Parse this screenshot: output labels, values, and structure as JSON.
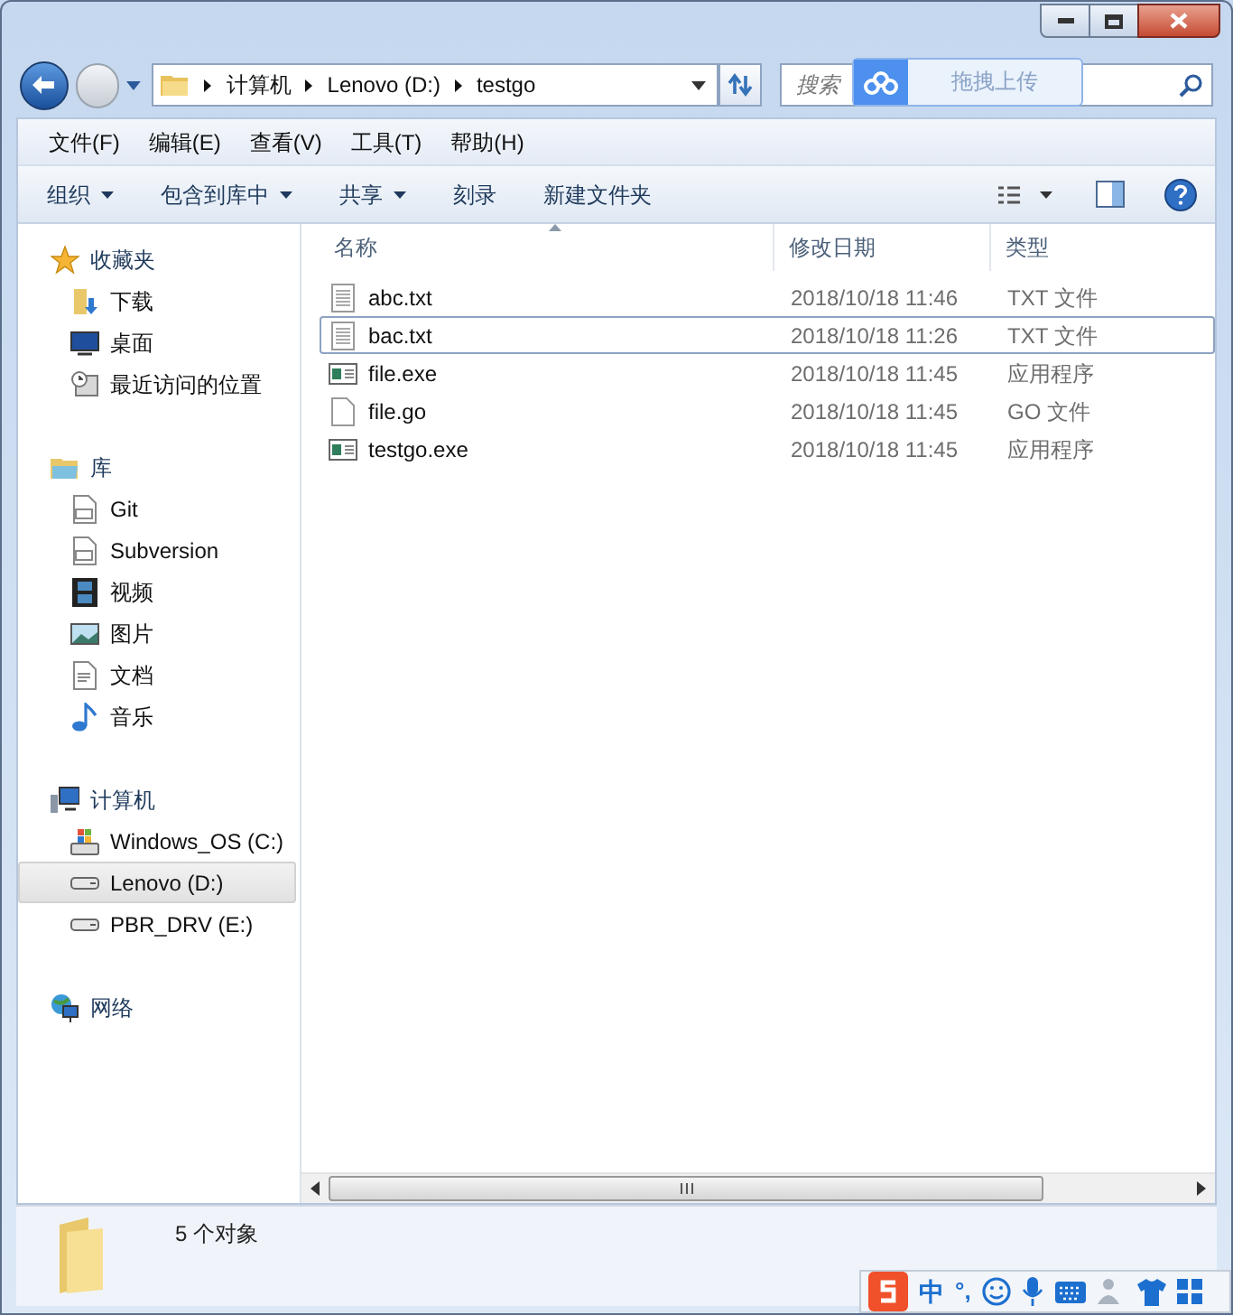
{
  "address_bar": {
    "segments": [
      "计算机",
      "Lenovo (D:)",
      "testgo"
    ]
  },
  "search": {
    "placeholder": "搜索"
  },
  "upload_overlay": {
    "label": "拖拽上传"
  },
  "menu": [
    "文件(F)",
    "编辑(E)",
    "查看(V)",
    "工具(T)",
    "帮助(H)"
  ],
  "toolbar": [
    {
      "label": "组织",
      "dropdown": true
    },
    {
      "label": "包含到库中",
      "dropdown": true
    },
    {
      "label": "共享",
      "dropdown": true
    },
    {
      "label": "刻录",
      "dropdown": false
    },
    {
      "label": "新建文件夹",
      "dropdown": false
    }
  ],
  "nav_pane": [
    {
      "label": "收藏夹",
      "kind": "star",
      "children": [
        {
          "label": "下载",
          "kind": "download",
          "selected": false
        },
        {
          "label": "桌面",
          "kind": "desktop",
          "selected": false
        },
        {
          "label": "最近访问的位置",
          "kind": "recent",
          "selected": false
        }
      ]
    },
    {
      "label": "库",
      "kind": "library",
      "children": [
        {
          "label": "Git",
          "kind": "git",
          "selected": false
        },
        {
          "label": "Subversion",
          "kind": "svn",
          "selected": false
        },
        {
          "label": "视频",
          "kind": "video",
          "selected": false
        },
        {
          "label": "图片",
          "kind": "picture",
          "selected": false
        },
        {
          "label": "文档",
          "kind": "document",
          "selected": false
        },
        {
          "label": "音乐",
          "kind": "music",
          "selected": false
        }
      ]
    },
    {
      "label": "计算机",
      "kind": "computer",
      "children": [
        {
          "label": "Windows_OS (C:)",
          "kind": "windows-drive",
          "selected": false
        },
        {
          "label": "Lenovo (D:)",
          "kind": "drive",
          "selected": true
        },
        {
          "label": "PBR_DRV (E:)",
          "kind": "drive",
          "selected": false
        }
      ]
    },
    {
      "label": "网络",
      "kind": "network"
    }
  ],
  "file_list": {
    "columns": [
      "名称",
      "修改日期",
      "类型"
    ],
    "rows": [
      {
        "name": "abc.txt",
        "modified": "2018/10/18 11:46",
        "type": "TXT 文件",
        "kind": "text",
        "focused": false
      },
      {
        "name": "bac.txt",
        "modified": "2018/10/18 11:26",
        "type": "TXT 文件",
        "kind": "text",
        "focused": true
      },
      {
        "name": "file.exe",
        "modified": "2018/10/18 11:45",
        "type": "应用程序",
        "kind": "exe",
        "focused": false
      },
      {
        "name": "file.go",
        "modified": "2018/10/18 11:45",
        "type": "GO 文件",
        "kind": "blank",
        "focused": false
      },
      {
        "name": "testgo.exe",
        "modified": "2018/10/18 11:45",
        "type": "应用程序",
        "kind": "exe",
        "focused": false
      }
    ]
  },
  "status_bar": {
    "text": "5 个对象"
  },
  "ime_bar": {
    "mode": "中",
    "punctuation": "°,"
  }
}
